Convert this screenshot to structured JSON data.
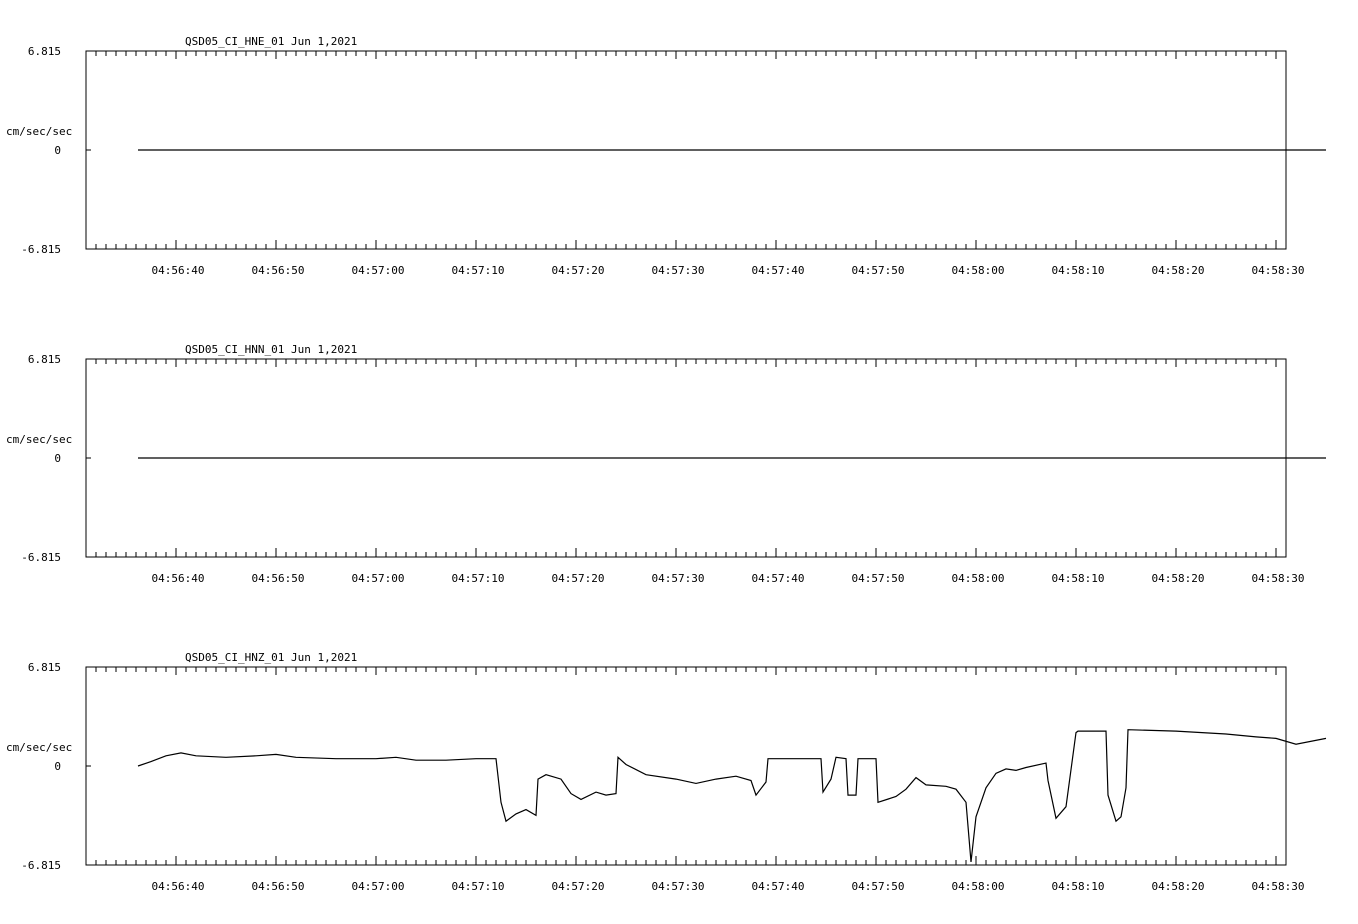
{
  "chart_data": [
    {
      "type": "line",
      "title": "QSD05_CI_HNE_01  Jun 1,2021",
      "ylabel": "cm/sec/sec",
      "ylim": [
        -6.815,
        6.815
      ],
      "yticks": [
        "6.815",
        "0",
        "-6.815"
      ],
      "xticks": [
        "04:56:40",
        "04:56:50",
        "04:57:00",
        "04:57:10",
        "04:57:20",
        "04:57:30",
        "04:57:40",
        "04:57:50",
        "04:58:00",
        "04:58:10",
        "04:58:20",
        "04:58:30"
      ],
      "series": [
        {
          "values": [
            [
              36.2,
              0.0
            ],
            [
              50.0,
              0.0
            ],
            [
              60.0,
              0.0
            ],
            [
              70.0,
              0.0
            ],
            [
              80.0,
              0.0
            ],
            [
              90.0,
              0.0
            ],
            [
              100.0,
              0.0
            ],
            [
              110.0,
              0.0
            ],
            [
              120.0,
              0.0
            ],
            [
              130.0,
              0.0
            ],
            [
              140.0,
              0.0
            ],
            [
              150.0,
              0.0
            ],
            [
              155.0,
              0.0
            ]
          ]
        }
      ]
    },
    {
      "type": "line",
      "title": "QSD05_CI_HNN_01  Jun 1,2021",
      "ylabel": "cm/sec/sec",
      "ylim": [
        -6.815,
        6.815
      ],
      "yticks": [
        "6.815",
        "0",
        "-6.815"
      ],
      "xticks": [
        "04:56:40",
        "04:56:50",
        "04:57:00",
        "04:57:10",
        "04:57:20",
        "04:57:30",
        "04:57:40",
        "04:57:50",
        "04:58:00",
        "04:58:10",
        "04:58:20",
        "04:58:30"
      ],
      "series": [
        {
          "values": [
            [
              36.2,
              0.0
            ],
            [
              50.0,
              0.0
            ],
            [
              60.0,
              0.0
            ],
            [
              70.0,
              0.0
            ],
            [
              80.0,
              0.0
            ],
            [
              90.0,
              0.0
            ],
            [
              100.0,
              0.0
            ],
            [
              110.0,
              0.0
            ],
            [
              120.0,
              0.0
            ],
            [
              130.0,
              0.0
            ],
            [
              140.0,
              0.0
            ],
            [
              150.0,
              0.0
            ],
            [
              155.0,
              0.0
            ]
          ]
        }
      ]
    },
    {
      "type": "line",
      "title": "QSD05_CI_HNZ_01  Jun 1,2021",
      "ylabel": "cm/sec/sec",
      "ylim": [
        -6.815,
        6.815
      ],
      "yticks": [
        "6.815",
        "0",
        "-6.815"
      ],
      "xticks": [
        "04:56:40",
        "04:56:50",
        "04:57:00",
        "04:57:10",
        "04:57:20",
        "04:57:30",
        "04:57:40",
        "04:57:50",
        "04:58:00",
        "04:58:10",
        "04:58:20",
        "04:58:30"
      ],
      "series": [
        {
          "values": [
            [
              36.2,
              0.0
            ],
            [
              37.5,
              0.3
            ],
            [
              39.0,
              0.7
            ],
            [
              40.5,
              0.9
            ],
            [
              42.0,
              0.7
            ],
            [
              45.0,
              0.6
            ],
            [
              48.0,
              0.7
            ],
            [
              50.0,
              0.8
            ],
            [
              52.0,
              0.6
            ],
            [
              56.0,
              0.5
            ],
            [
              60.0,
              0.5
            ],
            [
              62.0,
              0.6
            ],
            [
              64.0,
              0.4
            ],
            [
              67.0,
              0.4
            ],
            [
              70.0,
              0.5
            ],
            [
              72.0,
              0.5
            ],
            [
              72.5,
              -2.5
            ],
            [
              73.0,
              -3.8
            ],
            [
              74.0,
              -3.3
            ],
            [
              75.0,
              -3.0
            ],
            [
              76.0,
              -3.4
            ],
            [
              76.2,
              -0.9
            ],
            [
              77.0,
              -0.6
            ],
            [
              78.5,
              -0.9
            ],
            [
              79.5,
              -1.9
            ],
            [
              80.5,
              -2.3
            ],
            [
              82.0,
              -1.8
            ],
            [
              83.0,
              -2.0
            ],
            [
              84.0,
              -1.9
            ],
            [
              84.2,
              0.6
            ],
            [
              85.0,
              0.1
            ],
            [
              87.0,
              -0.6
            ],
            [
              90.0,
              -0.9
            ],
            [
              92.0,
              -1.2
            ],
            [
              94.0,
              -0.9
            ],
            [
              96.0,
              -0.7
            ],
            [
              97.5,
              -1.0
            ],
            [
              98.0,
              -2.0
            ],
            [
              99.0,
              -1.1
            ],
            [
              99.2,
              0.5
            ],
            [
              101.0,
              0.5
            ],
            [
              103.0,
              0.5
            ],
            [
              104.5,
              0.5
            ],
            [
              104.7,
              -1.8
            ],
            [
              105.5,
              -0.9
            ],
            [
              106.0,
              0.6
            ],
            [
              107.0,
              0.5
            ],
            [
              107.2,
              -2.0
            ],
            [
              108.0,
              -2.0
            ],
            [
              108.2,
              0.5
            ],
            [
              110.0,
              0.5
            ],
            [
              110.2,
              -2.5
            ],
            [
              112.0,
              -2.1
            ],
            [
              113.0,
              -1.6
            ],
            [
              114.0,
              -0.8
            ],
            [
              115.0,
              -1.3
            ],
            [
              117.0,
              -1.4
            ],
            [
              118.0,
              -1.6
            ],
            [
              119.0,
              -2.5
            ],
            [
              119.5,
              -6.6
            ],
            [
              120.0,
              -3.5
            ],
            [
              121.0,
              -1.5
            ],
            [
              122.0,
              -0.5
            ],
            [
              123.0,
              -0.2
            ],
            [
              124.0,
              -0.3
            ],
            [
              125.0,
              -0.1
            ],
            [
              127.0,
              0.2
            ],
            [
              127.2,
              -1.0
            ],
            [
              128.0,
              -3.6
            ],
            [
              129.0,
              -2.8
            ],
            [
              130.0,
              2.3
            ],
            [
              130.2,
              2.4
            ],
            [
              133.0,
              2.4
            ],
            [
              133.2,
              -2.0
            ],
            [
              134.0,
              -3.8
            ],
            [
              134.5,
              -3.5
            ],
            [
              135.0,
              -1.5
            ],
            [
              135.2,
              2.5
            ],
            [
              140.0,
              2.4
            ],
            [
              145.0,
              2.2
            ],
            [
              148.0,
              2.0
            ],
            [
              150.0,
              1.9
            ],
            [
              152.0,
              1.5
            ],
            [
              155.0,
              1.9
            ]
          ]
        }
      ]
    }
  ]
}
